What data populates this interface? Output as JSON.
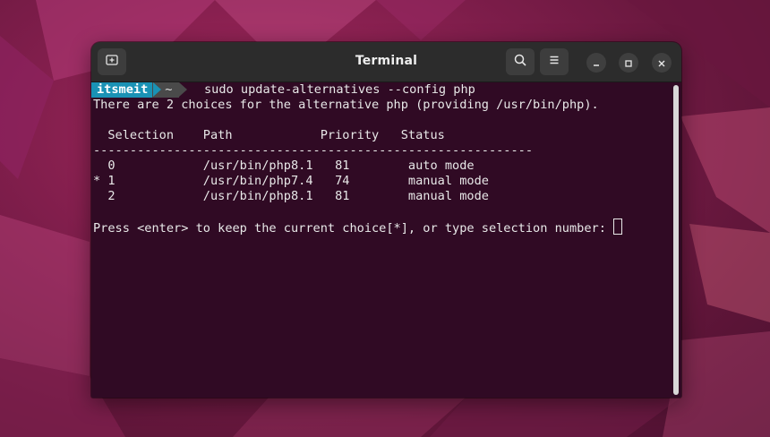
{
  "window": {
    "title": "Terminal"
  },
  "prompt": {
    "user": "itsmeit",
    "dir": "~",
    "command": "sudo update-alternatives --config php"
  },
  "output": {
    "line1": "There are 2 choices for the alternative php (providing /usr/bin/php).",
    "header": "  Selection    Path            Priority   Status",
    "separator": "------------------------------------------------------------",
    "rows": [
      "  0            /usr/bin/php8.1   81        auto mode",
      "* 1            /usr/bin/php7.4   74        manual mode",
      "  2            /usr/bin/php8.1   81        manual mode"
    ],
    "question": "Press <enter> to keep the current choice[*], or type selection number: "
  },
  "icons": {
    "new_tab": "new-tab-icon",
    "search": "search-icon",
    "menu": "hamburger-menu-icon",
    "minimize": "minimize-icon",
    "maximize": "maximize-icon",
    "close": "close-icon"
  },
  "colors": {
    "terminal_bg": "#300a24",
    "prompt_user_bg": "#1a92b5",
    "prompt_dir_bg": "#4a4a4a",
    "titlebar_bg": "#2c2c2c"
  }
}
